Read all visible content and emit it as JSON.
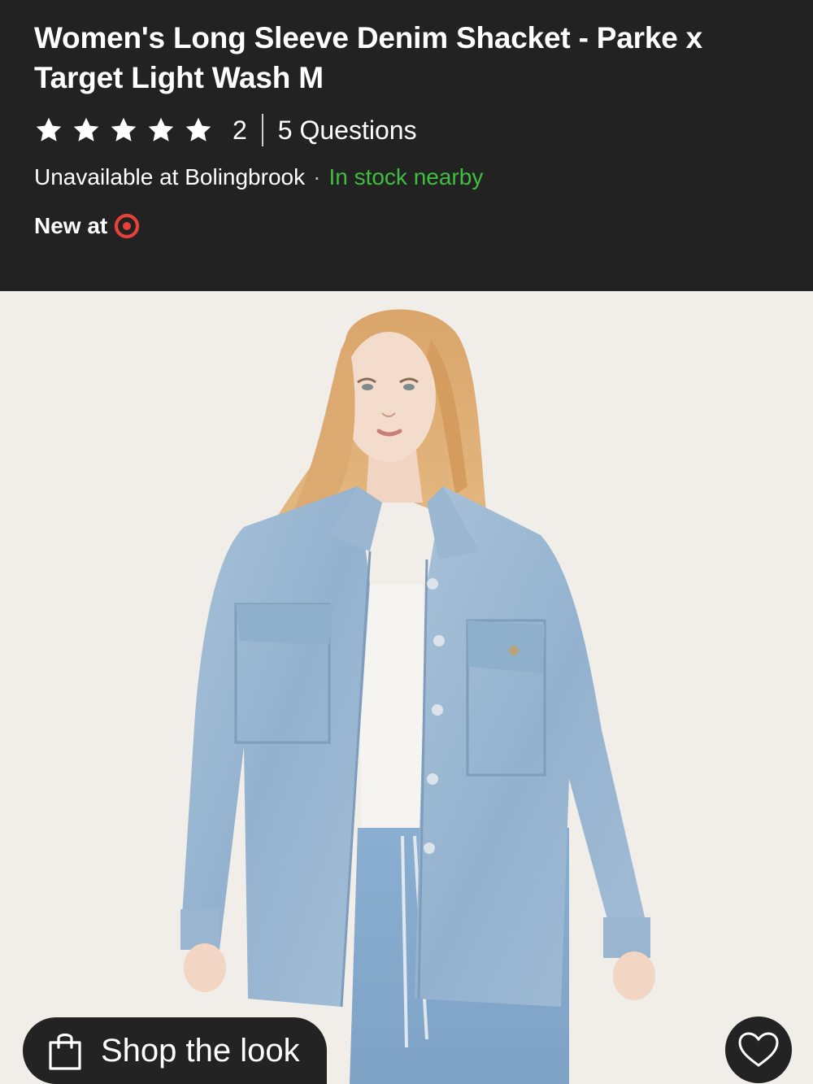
{
  "product": {
    "title": "Women's Long Sleeve Denim Shacket - Parke x Target Light Wash M",
    "rating": 5,
    "rating_max": 5,
    "review_count": "2",
    "questions": "5 Questions"
  },
  "availability": {
    "store_status": "Unavailable at Bolingbrook",
    "separator": "·",
    "nearby_status": "In stock nearby"
  },
  "badge": {
    "label": "New at",
    "logo_icon": "target-logo-icon"
  },
  "actions": {
    "shop_the_look": "Shop the look",
    "shop_icon": "shopping-bag-icon",
    "favorite_icon": "heart-icon"
  },
  "colors": {
    "header_bg": "#222222",
    "in_stock": "#3fbf3f",
    "target_red": "#e8403a",
    "image_bg": "#f1ede8"
  }
}
